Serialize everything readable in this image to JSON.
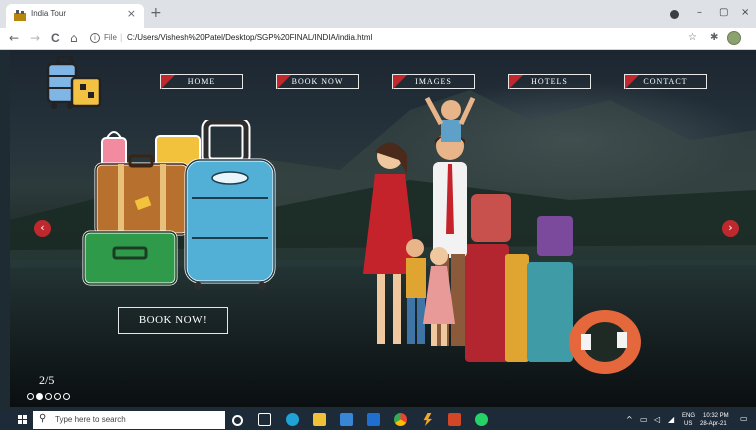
{
  "browser": {
    "tab_title": "India Tour",
    "tab_close": "×",
    "new_tab": "+",
    "url_scheme": "File",
    "url_separator": "|",
    "url": "C:/Users/Vishesh%20Patel/Desktop/SGP%20FINAL/INDIA/india.html",
    "window_controls": {
      "minimize": "–",
      "maximize": "▢",
      "close": "×"
    },
    "nav": {
      "back": "←",
      "forward": "→",
      "reload": "C",
      "home": "⌂"
    },
    "icons": {
      "bookmark": "star-icon",
      "extensions": "puzzle-icon",
      "profile": "avatar"
    }
  },
  "page": {
    "nav": [
      "HOME",
      "BOOK NOW",
      "IMAGES",
      "HOTELS",
      "CONTACT"
    ],
    "hero_button": "BOOK NOW!",
    "prev_arrow": "‹",
    "next_arrow": "›",
    "slide_counter": "2/5",
    "slides_total": 5,
    "active_slide": 2,
    "accent_color": "#c0282d"
  },
  "taskbar": {
    "search_placeholder": "Type here to search",
    "lang_top": "ENG",
    "lang_bottom": "US",
    "time": "10:32 PM",
    "date": "28-Apr-21",
    "tray_arrow": "^"
  }
}
